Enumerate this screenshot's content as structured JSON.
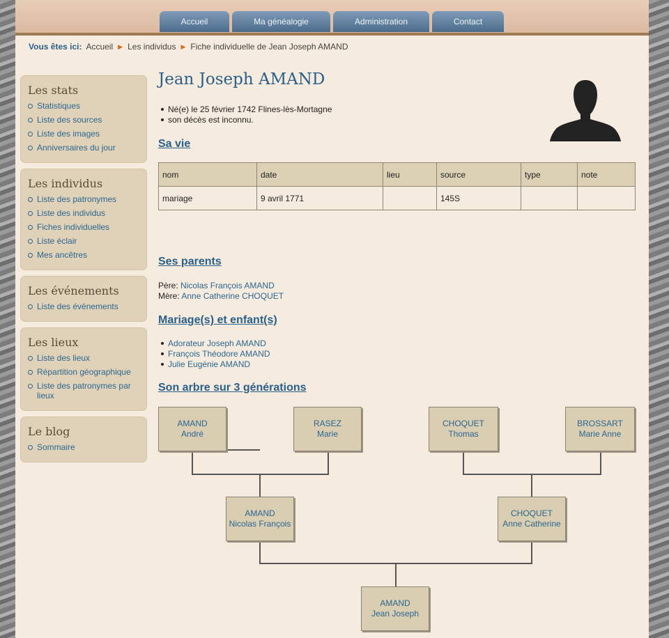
{
  "nav": {
    "tabs": [
      "Accueil",
      "Ma généalogie",
      "Administration",
      "Contact"
    ]
  },
  "breadcrumb": {
    "label": "Vous êtes ici:",
    "items": [
      "Accueil",
      "Les individus",
      "Fiche individuelle de Jean Joseph AMAND"
    ]
  },
  "sidebar": [
    {
      "title": "Les stats",
      "items": [
        "Statistiques",
        "Liste des sources",
        "Liste des images",
        "Anniversaires du jour"
      ]
    },
    {
      "title": "Les individus",
      "items": [
        "Liste des patronymes",
        "Liste des individus",
        "Fiches individuelles",
        "Liste éclair",
        "Mes ancêtres"
      ]
    },
    {
      "title": "Les événements",
      "items": [
        "Liste des événements"
      ]
    },
    {
      "title": "Les lieux",
      "items": [
        "Liste des lieux",
        "Répartition géographique",
        "Liste des patronymes par lieux"
      ]
    },
    {
      "title": "Le blog",
      "items": [
        "Sommaire"
      ]
    }
  ],
  "person": {
    "name": "Jean Joseph AMAND",
    "facts": [
      "Né(e) le 25 février 1742 Flines-lès-Mortagne",
      "son décès est inconnu."
    ]
  },
  "sections": {
    "life": "Sa vie",
    "parents": "Ses parents",
    "marriages": "Mariage(s) et enfant(s)",
    "tree": "Son arbre sur 3 générations"
  },
  "events_table": {
    "headers": [
      "nom",
      "date",
      "lieu",
      "source",
      "type",
      "note"
    ],
    "rows": [
      [
        "mariage",
        "9 avril 1771",
        "",
        "145S",
        "",
        ""
      ]
    ]
  },
  "parents": {
    "father_label": "Père:",
    "father": "Nicolas François AMAND",
    "mother_label": "Mère:",
    "mother": "Anne Catherine CHOQUET"
  },
  "children": [
    "Adorateur Joseph AMAND",
    "François Théodore AMAND",
    "Julie Eugénie AMAND"
  ],
  "tree": {
    "gp1": {
      "surname": "AMAND",
      "given": "André"
    },
    "gp2": {
      "surname": "RASEZ",
      "given": "Marie"
    },
    "gp3": {
      "surname": "CHOQUET",
      "given": "Thomas"
    },
    "gp4": {
      "surname": "BROSSART",
      "given": "Marie Anne"
    },
    "father": {
      "surname": "AMAND",
      "given": "Nicolas François"
    },
    "mother": {
      "surname": "CHOQUET",
      "given": "Anne Catherine"
    },
    "self": {
      "surname": "AMAND",
      "given": "Jean Joseph"
    }
  },
  "colors": {
    "accent": "#2a5f8a",
    "link": "#2d6690",
    "background": "#f5ebde",
    "sidebar": "#dfd2b8"
  },
  "icons": {
    "breadcrumb_separator": "triangle-right-icon",
    "silhouette": "person-silhouette-icon"
  }
}
